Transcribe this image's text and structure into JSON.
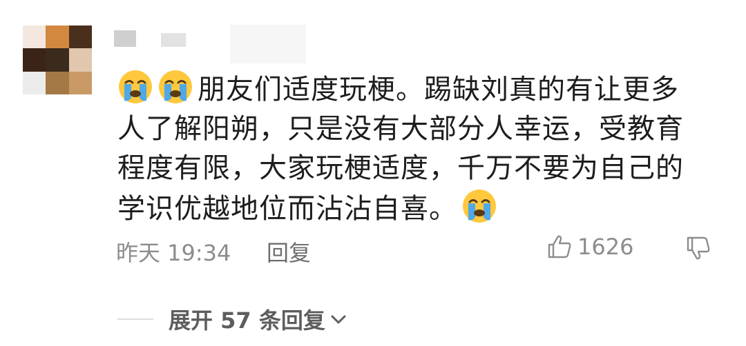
{
  "comment": {
    "text": "朋友们适度玩梗。踢缺刘真的有让更多人了解阳朔，只是没有大部分人幸运，受教育程度有限，大家玩梗适度，千万不要为自己的学识优越地位而沾沾自喜。",
    "leading_icons": [
      "loudly-crying-face-icon",
      "loudly-crying-face-icon"
    ],
    "trailing_icons": [
      "loudly-crying-face-icon"
    ]
  },
  "meta": {
    "time": "昨天 19:34",
    "reply_label": "回复",
    "like_count": "1626",
    "like_icon": "thumbs-up-icon",
    "dislike_icon": "thumbs-down-icon"
  },
  "expand": {
    "label": "展开 57 条回复",
    "icon": "chevron-down-icon"
  },
  "colors": {
    "text": "#1d1d1d",
    "meta": "#8c8c8c",
    "expand": "#5d5d5d",
    "emoji_face": "#FFC83D",
    "emoji_tears": "#4FA8E8"
  }
}
